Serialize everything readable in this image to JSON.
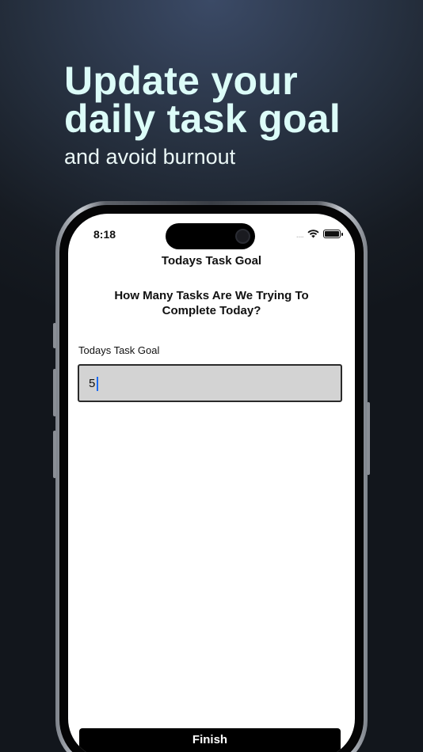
{
  "promo": {
    "headline_line1": "Update your",
    "headline_line2": "daily task goal",
    "subline": "and avoid burnout"
  },
  "status_bar": {
    "time": "8:18",
    "signal": "....",
    "wifi_icon": "wifi-icon",
    "battery_icon": "battery-icon"
  },
  "screen": {
    "nav_title": "Todays Task Goal",
    "question": "How Many Tasks Are We Trying To Complete Today?",
    "field_label": "Todays Task Goal",
    "field_value": "5",
    "finish_label": "Finish"
  },
  "colors": {
    "headline": "#dcfcf8",
    "background_dark": "#161b22",
    "input_bg": "#d3d3d3",
    "button_bg": "#000000",
    "caret": "#1b6bf2"
  }
}
